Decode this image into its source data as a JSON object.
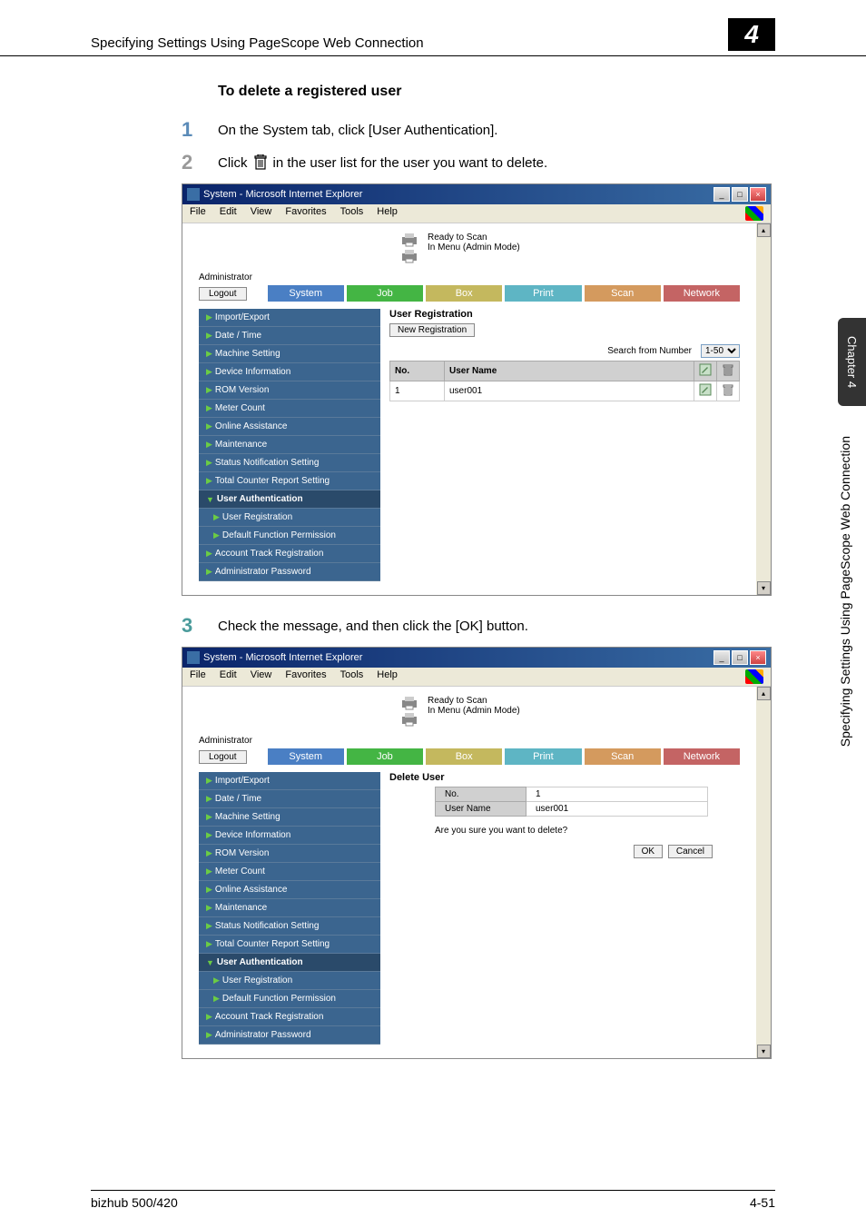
{
  "header": {
    "text": "Specifying Settings Using PageScope Web Connection",
    "badge": "4"
  },
  "section_heading": "To delete a registered user",
  "steps": {
    "s1": {
      "num": "1",
      "text": "On the System tab, click [User Authentication]."
    },
    "s2": {
      "num": "2",
      "pre": "Click",
      "post": "in the user list for the user you want to delete."
    },
    "s3": {
      "num": "3",
      "text": "Check the message, and then click the [OK] button."
    }
  },
  "ie": {
    "title": "System - Microsoft Internet Explorer",
    "menu": {
      "file": "File",
      "edit": "Edit",
      "view": "View",
      "favorites": "Favorites",
      "tools": "Tools",
      "help": "Help"
    },
    "status1": "Ready to Scan",
    "status2": "In Menu (Admin Mode)",
    "admin": "Administrator",
    "logout": "Logout",
    "tabs": {
      "system": "System",
      "job": "Job",
      "box": "Box",
      "print": "Print",
      "scan": "Scan",
      "network": "Network"
    },
    "sidebar": [
      "Import/Export",
      "Date / Time",
      "Machine Setting",
      "Device Information",
      "ROM Version",
      "Meter Count",
      "Online Assistance",
      "Maintenance",
      "Status Notification Setting",
      "Total Counter Report Setting",
      "User Authentication",
      "User Registration",
      "Default Function Permission",
      "Account Track Registration",
      "Administrator Password"
    ]
  },
  "screen1": {
    "heading": "User Registration",
    "newreg": "New Registration",
    "search_label": "Search from Number",
    "search_range": "1-50",
    "col_no": "No.",
    "col_user": "User Name",
    "row1_no": "1",
    "row1_user": "user001"
  },
  "screen2": {
    "heading": "Delete User",
    "no_label": "No.",
    "no_val": "1",
    "user_label": "User Name",
    "user_val": "user001",
    "confirm": "Are you sure you want to delete?",
    "ok": "OK",
    "cancel": "Cancel"
  },
  "side_tab": "Chapter 4",
  "side_label": "Specifying Settings Using PageScope Web Connection",
  "footer": {
    "left": "bizhub 500/420",
    "right": "4-51"
  }
}
